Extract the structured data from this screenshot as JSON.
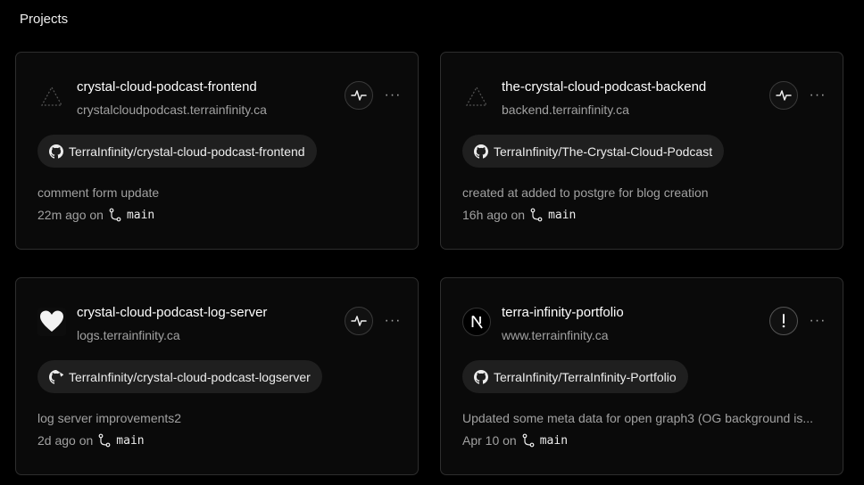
{
  "header": {
    "title": "Projects"
  },
  "projects": [
    {
      "name": "crystal-cloud-podcast-frontend",
      "url": "crystalcloudpodcast.terrainfinity.ca",
      "icon": "triangle-placeholder-icon",
      "repo": "TerraInfinity/crystal-cloud-podcast-frontend",
      "commit_message": "comment form update",
      "time": "22m ago on",
      "branch": "main",
      "status_icon": "activity-pulse-icon"
    },
    {
      "name": "the-crystal-cloud-podcast-backend",
      "url": "backend.terrainfinity.ca",
      "icon": "triangle-placeholder-icon",
      "repo": "TerraInfinity/The-Crystal-Cloud-Podcast",
      "commit_message": "created at added to postgre for blog creation",
      "time": "16h ago on",
      "branch": "main",
      "status_icon": "activity-pulse-icon"
    },
    {
      "name": "crystal-cloud-podcast-log-server",
      "url": "logs.terrainfinity.ca",
      "icon": "heart-icon",
      "repo": "TerraInfinity/crystal-cloud-podcast-logserver",
      "commit_message": "log server improvements2",
      "time": "2d ago on",
      "branch": "main",
      "status_icon": "activity-pulse-icon"
    },
    {
      "name": "terra-infinity-portfolio",
      "url": "www.terrainfinity.ca",
      "icon": "nextjs-logo-icon",
      "repo": "TerraInfinity/TerraInfinity-Portfolio",
      "commit_message": "Updated some meta data for open graph3 (OG background is...",
      "time": "Apr 10 on",
      "branch": "main",
      "status_icon": "exclamation-warning-icon"
    }
  ],
  "more_label": "···"
}
